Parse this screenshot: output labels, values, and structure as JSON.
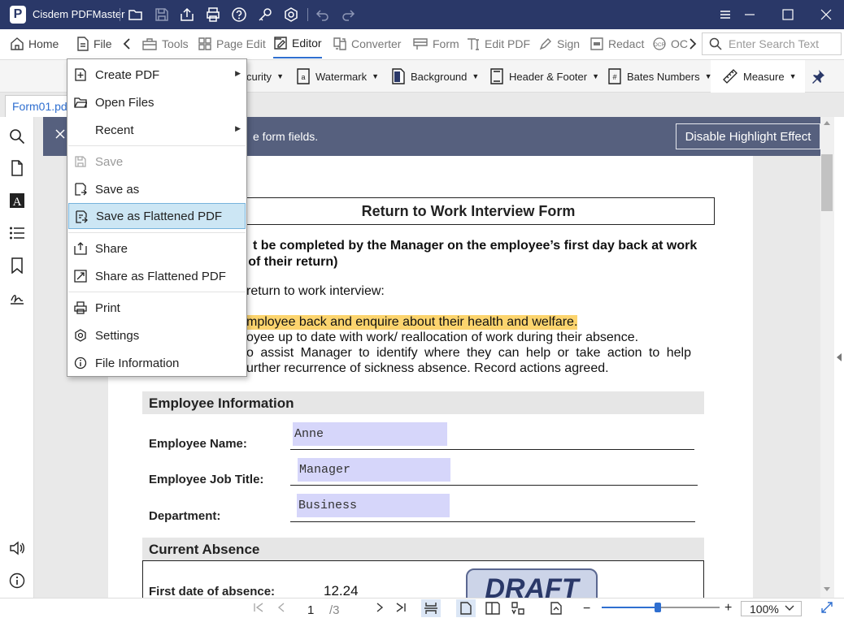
{
  "app": {
    "title": "Cisdem PDFMaster",
    "logo_letter": "P"
  },
  "tabs": {
    "home": "Home",
    "file": "File",
    "tools": "Tools",
    "page_edit": "Page Edit",
    "editor": "Editor",
    "converter": "Converter",
    "form": "Form",
    "edit_pdf": "Edit PDF",
    "sign": "Sign",
    "redact": "Redact",
    "ocr": "OC"
  },
  "search": {
    "placeholder": "Enter Search Text"
  },
  "subtoolbar": {
    "security": "curity",
    "watermark": "Watermark",
    "background": "Background",
    "header_footer": "Header & Footer",
    "bates": "Bates Numbers",
    "measure": "Measure"
  },
  "file_tab": {
    "name": "Form01.pd"
  },
  "notice": {
    "text": "e form fields.",
    "button": "Disable Highlight Effect"
  },
  "document": {
    "title": "Return to Work Interview Form",
    "intro_line1": "t be completed by the Manager on the employee’s first day back at work",
    "intro_line2": "ys of their return)",
    "purpose": "return to work interview:",
    "bullet1": "mployee back and enquire about their health and welfare.",
    "bullet2": "oyee up to date with work/ reallocation of work during their absence.",
    "bullet3a": "o assist Manager to identify where they can help or take action to help",
    "bullet3b": "urther recurrence of sickness absence. Record actions agreed.",
    "section_employee": "Employee Information",
    "label_name": "Employee Name:",
    "label_title": "Employee Job Title:",
    "label_dept": "Department:",
    "value_name": "Anne",
    "value_title": "Manager",
    "value_dept": "Business",
    "section_absence": "Current Absence",
    "label_first_date": "First date of absence:",
    "value_first_date": "12.24",
    "stamp": "DRAFT"
  },
  "file_menu": {
    "create_pdf": "Create PDF",
    "open_files": "Open Files",
    "recent": "Recent",
    "save": "Save",
    "save_as": "Save as",
    "save_flattened": "Save as Flattened PDF",
    "share": "Share",
    "share_flattened": "Share as Flattened PDF",
    "print": "Print",
    "settings": "Settings",
    "file_info": "File Information"
  },
  "statusbar": {
    "current_page": "1",
    "total_pages": "/3",
    "zoom": "100%",
    "zoom_level": 0.48
  },
  "colors": {
    "titlebar": "#2a3868",
    "accent": "#2f6fd0",
    "highlight": "#fcd46e",
    "field_fill": "#d6d6fa",
    "notice_bar": "#56607e"
  }
}
